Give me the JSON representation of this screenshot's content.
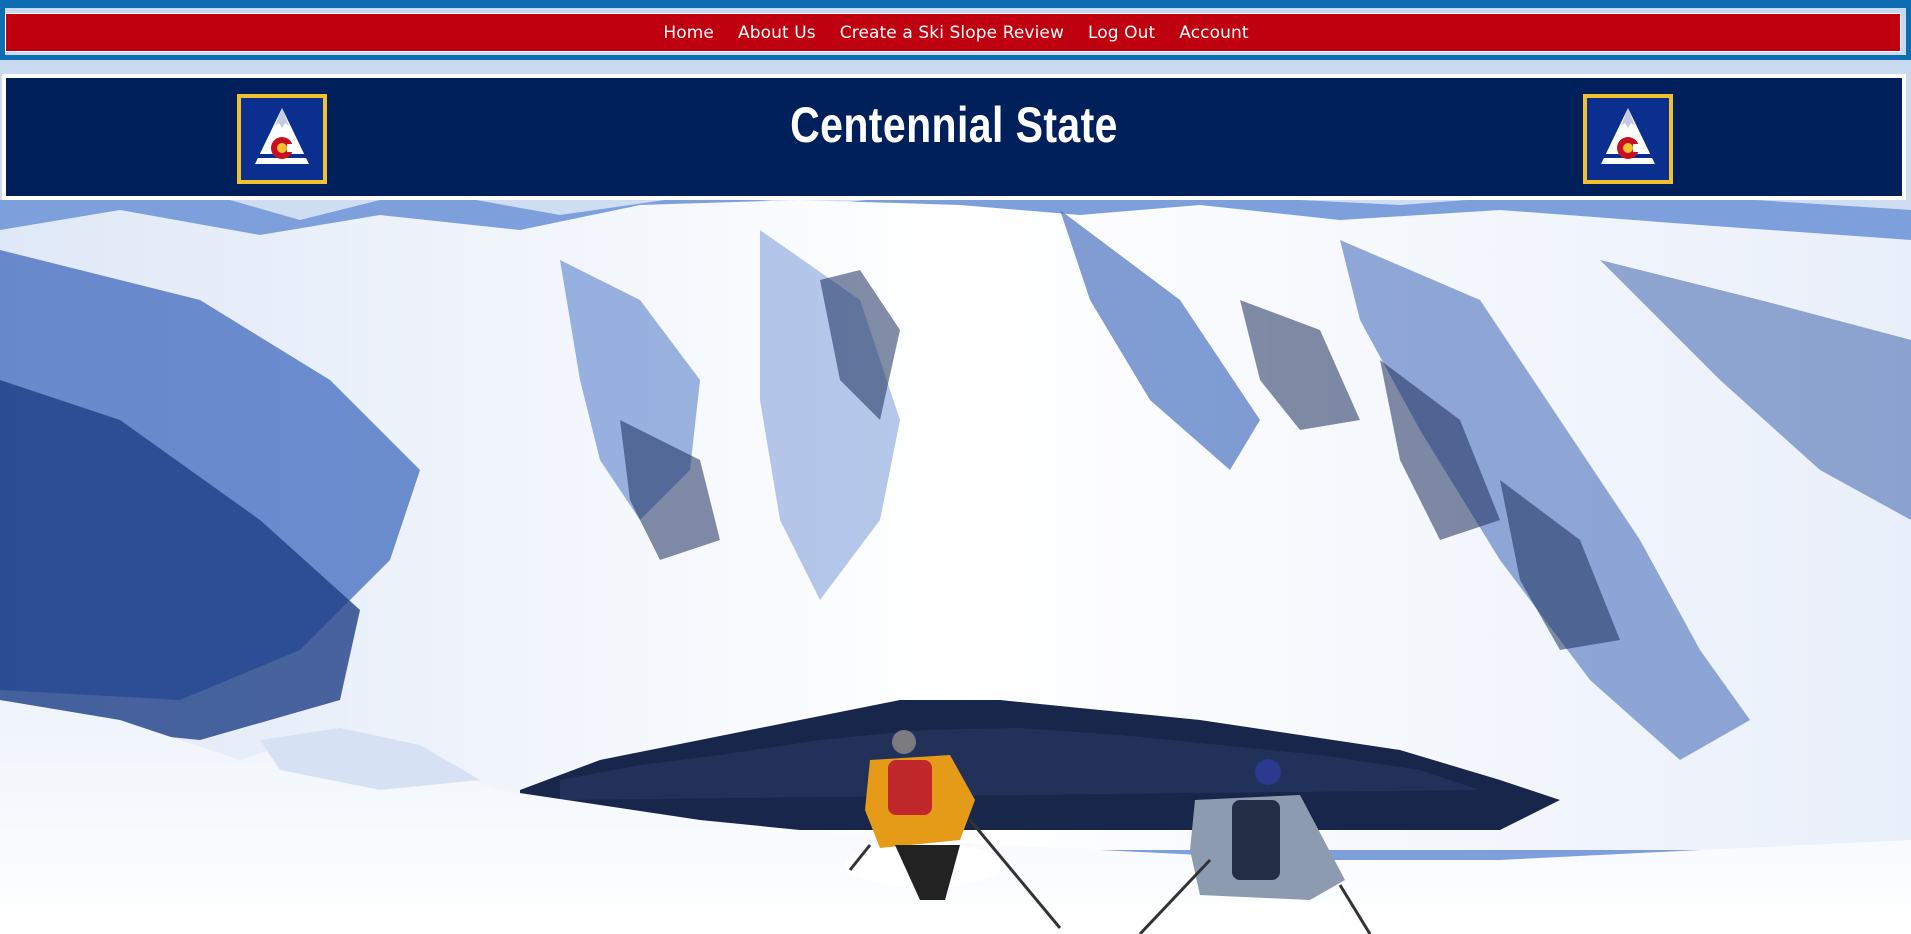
{
  "nav": {
    "links": [
      {
        "label": "Home"
      },
      {
        "label": "About Us"
      },
      {
        "label": "Create a Ski Slope Review"
      },
      {
        "label": "Log Out"
      },
      {
        "label": "Account"
      }
    ]
  },
  "header": {
    "title": "Centennial State"
  },
  "logos": {
    "icon": "mountain-colorado-c-logo-icon",
    "count": 2
  },
  "background": {
    "description_icon": "snowy-mountain-skiers-photo"
  },
  "colors": {
    "nav_background": "#bf000f",
    "nav_frame": "#0d6db3",
    "banner_background": "#00205b",
    "logo_border": "#f2c130",
    "logo_fill": "#0b2f8f",
    "text": "#ffffff"
  }
}
